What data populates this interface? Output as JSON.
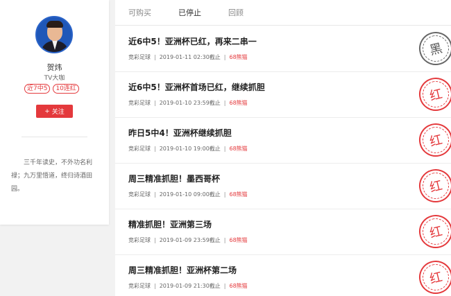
{
  "profile": {
    "name": "贺炜",
    "title": "TV大咖",
    "badges": [
      "近7中5",
      "10连红"
    ],
    "follow_label": "关注",
    "bio": "三千年读史，不外功名利禄；九万里悟道，终归诗酒田园。"
  },
  "tabs": [
    "可购买",
    "已停止",
    "回顾"
  ],
  "articles": [
    {
      "title": "近6中5！亚洲杯已红，再来二串一",
      "category": "竞彩足球",
      "time": "2019-01-11 02:30截止",
      "price": "68熊猫",
      "stamp": "黑"
    },
    {
      "title": "近6中5！亚洲杯首场已红，继续抓胆",
      "category": "竞彩足球",
      "time": "2019-01-10 23:59截止",
      "price": "68熊猫",
      "stamp": "红"
    },
    {
      "title": "昨日5中4！亚洲杯继续抓胆",
      "category": "竞彩足球",
      "time": "2019-01-10 19:00截止",
      "price": "68熊猫",
      "stamp": "红"
    },
    {
      "title": "周三精准抓胆！墨西哥杯",
      "category": "竞彩足球",
      "time": "2019-01-10 09:00截止",
      "price": "68熊猫",
      "stamp": "红"
    },
    {
      "title": "精准抓胆！亚洲第三场",
      "category": "竞彩足球",
      "time": "2019-01-09 23:59截止",
      "price": "68熊猫",
      "stamp": "红"
    },
    {
      "title": "周三精准抓胆！亚洲杯第二场",
      "category": "竞彩足球",
      "time": "2019-01-09 21:30截止",
      "price": "68熊猫",
      "stamp": "红"
    }
  ],
  "colors": {
    "accent": "#e4393c"
  }
}
